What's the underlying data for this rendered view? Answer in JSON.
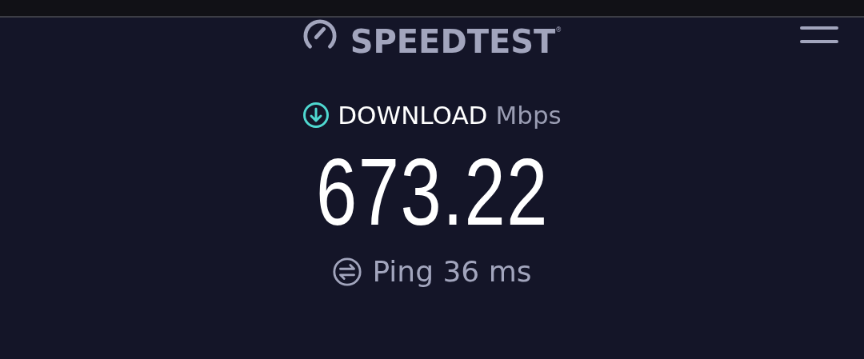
{
  "header": {
    "logo": "SPEEDTEST$^{®}$"
  },
  "result": {
    "label": "DOWNLOAD",
    "unit": "Mbps",
    "value": "673.22"
  },
  "ping": {
    "text": "Ping 36 ms"
  }
}
